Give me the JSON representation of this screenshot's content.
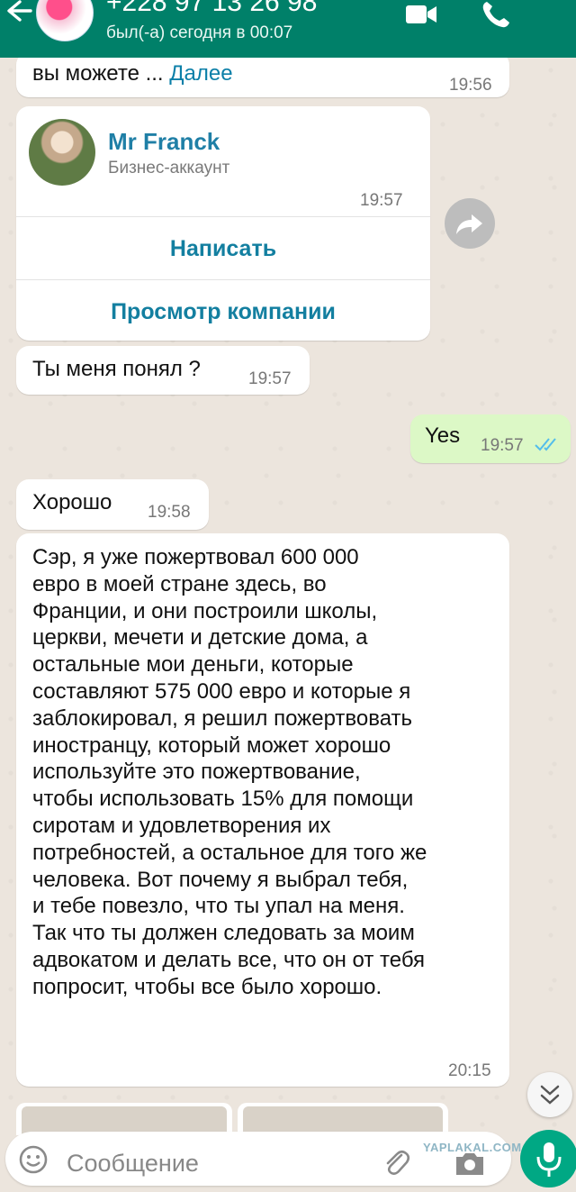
{
  "header": {
    "contact": "+228 97 13 26 98",
    "status": "был(-а) сегодня в 00:07"
  },
  "messages": {
    "m1": {
      "text": "вы можете ...",
      "more": "Далее",
      "time": "19:56"
    },
    "card": {
      "name": "Mr Franck",
      "subtitle": "Бизнес-аккаунт",
      "time": "19:57",
      "action1": "Написать",
      "action2": "Просмотр компании"
    },
    "m2": {
      "text": "Ты меня понял ?",
      "time": "19:57"
    },
    "m3": {
      "text": "Yes",
      "time": "19:57"
    },
    "m4": {
      "text": "Хорошо",
      "time": "19:58"
    },
    "m5": {
      "lines": [
        "Сэр, я уже пожертвовал 600 000",
        "евро в моей стране здесь, во",
        "Франции, и они построили школы,",
        "церкви, мечети и детские дома, а",
        "остальные мои деньги, которые",
        "составляют 575 000 евро и которые я",
        "заблокировал, я решил пожертвовать",
        "иностранцу, который может хорошо",
        "используйте это пожертвование,",
        "чтобы использовать 15% для помощи",
        "сиротам и удовлетворения их",
        "потребностей, а остальное для того же",
        "человека.  Вот почему я выбрал тебя,",
        "и тебе повезло, что ты упал на меня.",
        "Так что ты должен следовать за моим",
        "адвокатом и делать все, что он от тебя",
        "попросит, чтобы все было хорошо."
      ],
      "time": "20:15"
    }
  },
  "composer": {
    "placeholder": "Сообщение"
  },
  "watermark": "YAPLAKAL.COM",
  "icons": [
    "back-arrow-icon",
    "video-call-icon",
    "phone-icon",
    "forward-icon",
    "double-check-icon",
    "chevron-down-icon",
    "emoji-icon",
    "attach-icon",
    "camera-icon",
    "mic-icon"
  ],
  "colors": {
    "header": "#008069",
    "outgoing": "#dcf8c6",
    "incoming": "#ffffff",
    "link": "#1f7fa6",
    "read_ticks": "#53bdeb"
  }
}
